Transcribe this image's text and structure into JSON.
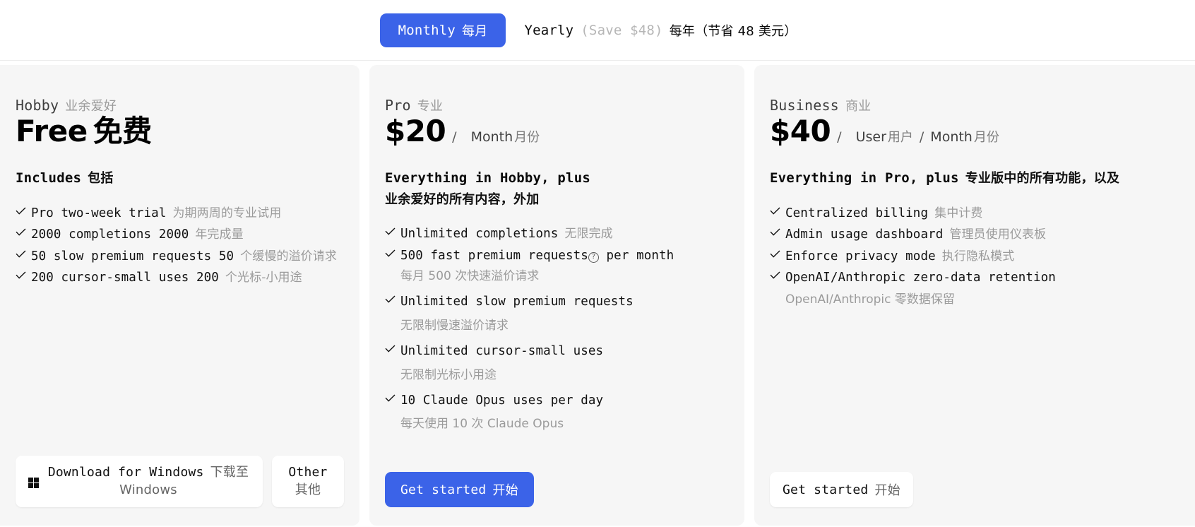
{
  "billing_toggle": {
    "monthly": {
      "label": "Monthly",
      "label_cn": "每月",
      "active": true
    },
    "yearly": {
      "label": "Yearly",
      "save_note": "(Save $48)",
      "label_cn": "每年（节省 48 美元）",
      "active": false
    }
  },
  "accent_color": "#3b63e8",
  "card_bg": "#f6f6f6",
  "plans": [
    {
      "name": "Hobby",
      "name_cn": "业余爱好",
      "price": "Free",
      "price_cn": "免费",
      "heading": "Includes",
      "heading_cn": "包括",
      "features": [
        {
          "en": "Pro two-week trial",
          "cn": "为期两周的专业试用",
          "inline": true
        },
        {
          "en": "2000 completions 2000",
          "cn": "年完成量",
          "inline": true
        },
        {
          "en": "50 slow premium requests 50",
          "cn": "个缓慢的溢价请求",
          "inline": true
        },
        {
          "en": "200 cursor-small uses 200",
          "cn": "个光标-小用途",
          "inline": true
        }
      ],
      "buttons": [
        {
          "label": "Download for Windows",
          "label_cn": "下载至 Windows",
          "style": "white",
          "icon": "windows-icon"
        },
        {
          "label": "Other",
          "label_cn": "其他",
          "style": "white"
        }
      ]
    },
    {
      "name": "Pro",
      "name_cn": "专业",
      "price": "$20",
      "price_units": [
        "Month"
      ],
      "price_units_cn": [
        "月份"
      ],
      "heading": "Everything in Hobby, plus",
      "heading_cn": "业余爱好的所有内容，外加",
      "features": [
        {
          "en": "Unlimited completions",
          "cn": "无限完成",
          "inline": true
        },
        {
          "en": "500 fast premium requests",
          "help": true,
          "en_tail": " per month",
          "cn_line": "每月 500 次快速溢价请求"
        },
        {
          "en": "Unlimited slow premium requests",
          "cn_line": "无限制慢速溢价请求"
        },
        {
          "en": "Unlimited cursor-small uses",
          "cn_line": "无限制光标小用途"
        },
        {
          "en": "10 Claude Opus uses per day",
          "cn_line": "每天使用 10 次 Claude Opus"
        }
      ],
      "buttons": [
        {
          "label": "Get started",
          "label_cn": "开始",
          "style": "blue"
        }
      ]
    },
    {
      "name": "Business",
      "name_cn": "商业",
      "price": "$40",
      "price_units": [
        "User",
        "Month"
      ],
      "price_units_cn": [
        "用户",
        "月份"
      ],
      "heading": "Everything in Pro, plus",
      "heading_cn": "专业版中的所有功能，以及",
      "features": [
        {
          "en": "Centralized billing",
          "cn": "集中计费",
          "inline": true
        },
        {
          "en": "Admin usage dashboard",
          "cn": "管理员使用仪表板",
          "inline": true
        },
        {
          "en": "Enforce privacy mode",
          "cn": "执行隐私模式",
          "inline": true
        },
        {
          "en": "OpenAI/Anthropic zero-data retention",
          "cn_line": "OpenAI/Anthropic 零数据保留",
          "cn_line_mono_prefix": "OpenAI/Anthropic"
        }
      ],
      "buttons": [
        {
          "label": "Get started",
          "label_cn": "开始",
          "style": "white"
        }
      ]
    }
  ]
}
